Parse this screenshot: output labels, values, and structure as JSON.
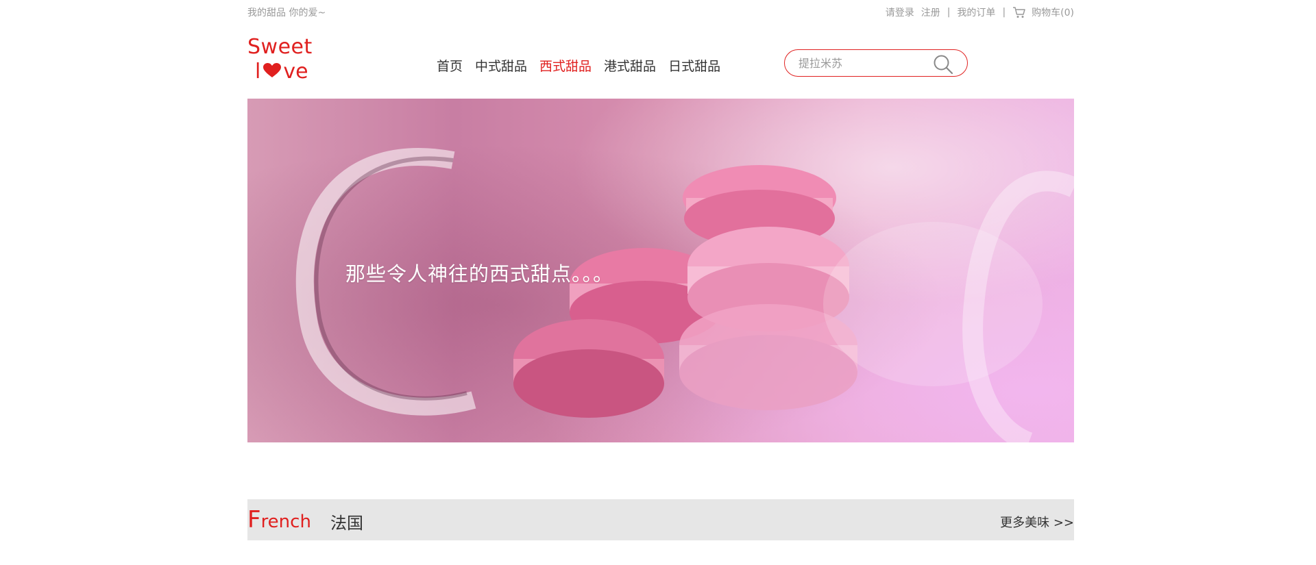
{
  "topbar": {
    "tagline": "我的甜品 你的爱~",
    "login": "请登录",
    "register": "注册",
    "sep": "|",
    "orders": "我的订单",
    "cart": "购物车(0)"
  },
  "logo": {
    "line1": "Sweet",
    "line2_pre": "l",
    "line2_post": "ve"
  },
  "nav": {
    "items": [
      {
        "label": "首页"
      },
      {
        "label": "中式甜品"
      },
      {
        "label": "西式甜品"
      },
      {
        "label": "港式甜品"
      },
      {
        "label": "日式甜品"
      }
    ],
    "active_index": 2
  },
  "search": {
    "placeholder": "提拉米苏"
  },
  "banner": {
    "caption": "那些令人神往的西式甜点。。。"
  },
  "section": {
    "first_letter": "F",
    "rest": "rench",
    "cn": "法国",
    "more": "更多美味 >>"
  },
  "colors": {
    "accent": "#e0201f",
    "section_bg": "#e6e6e6",
    "muted": "#999999"
  },
  "icons": [
    "cart-icon",
    "heart-icon",
    "search-icon"
  ]
}
